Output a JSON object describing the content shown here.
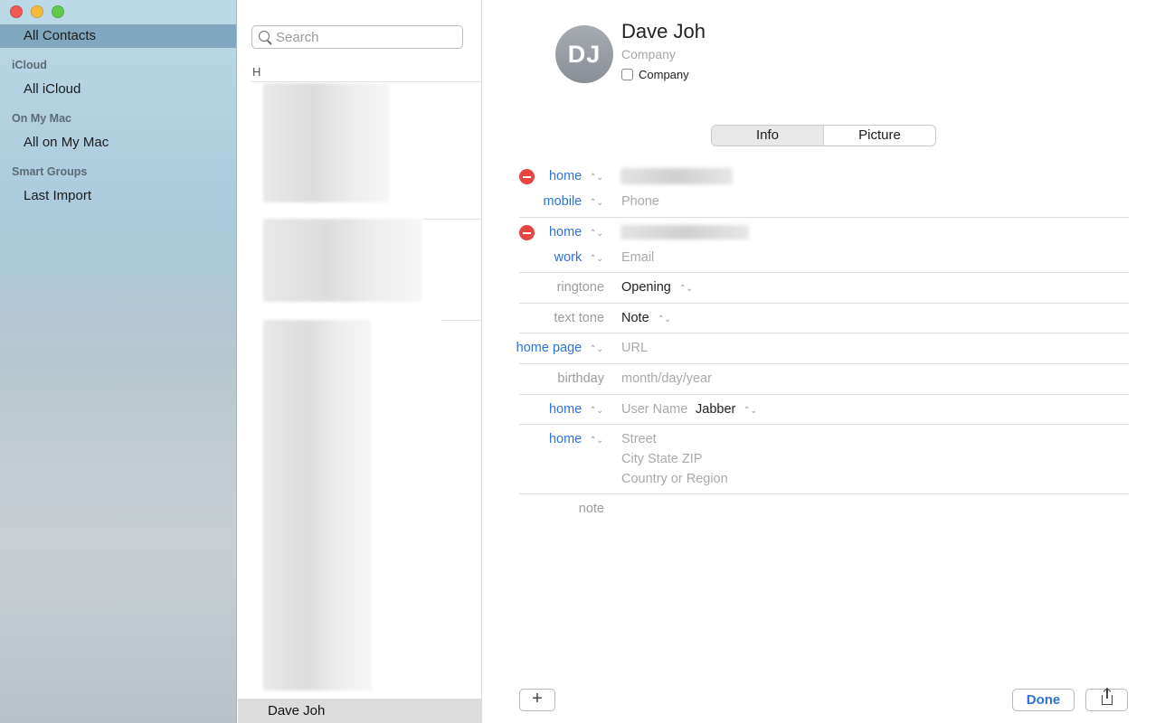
{
  "sidebar": {
    "window_controls": [
      "close",
      "minimize",
      "zoom"
    ],
    "items": [
      {
        "label": "All Contacts",
        "selected": true
      },
      {
        "header": "iCloud"
      },
      {
        "label": "All iCloud"
      },
      {
        "header": "On My Mac"
      },
      {
        "label": "All on My Mac"
      },
      {
        "header": "Smart Groups"
      },
      {
        "label": "Last Import"
      }
    ]
  },
  "list": {
    "search_placeholder": "Search",
    "section_letter": "H",
    "selected_contact": "Dave Joh"
  },
  "contact": {
    "initials": "DJ",
    "name": "Dave  Joh",
    "company_placeholder": "Company",
    "company_checkbox_label": "Company",
    "tabs": [
      {
        "label": "Info",
        "active": true
      },
      {
        "label": "Picture",
        "active": false
      }
    ],
    "phone": {
      "label1": "home",
      "label2": "mobile",
      "placeholder": "Phone"
    },
    "email": {
      "label1": "home",
      "label2": "work",
      "placeholder": "Email"
    },
    "ringtone": {
      "label": "ringtone",
      "value": "Opening"
    },
    "text_tone": {
      "label": "text tone",
      "value": "Note"
    },
    "home_page": {
      "label": "home page",
      "placeholder": "URL"
    },
    "birthday": {
      "label": "birthday",
      "placeholder": "month/day/year"
    },
    "im": {
      "label": "home",
      "placeholder": "User Name",
      "service": "Jabber"
    },
    "address": {
      "label": "home",
      "street": "Street",
      "city": "City  State  ZIP",
      "country": "Country or Region"
    },
    "note": {
      "label": "note"
    }
  },
  "buttons": {
    "add": "+",
    "done": "Done"
  },
  "colors": {
    "accent": "#2f73d8",
    "delete": "#e64540",
    "sidebar_selected": "#7fa7bf"
  }
}
